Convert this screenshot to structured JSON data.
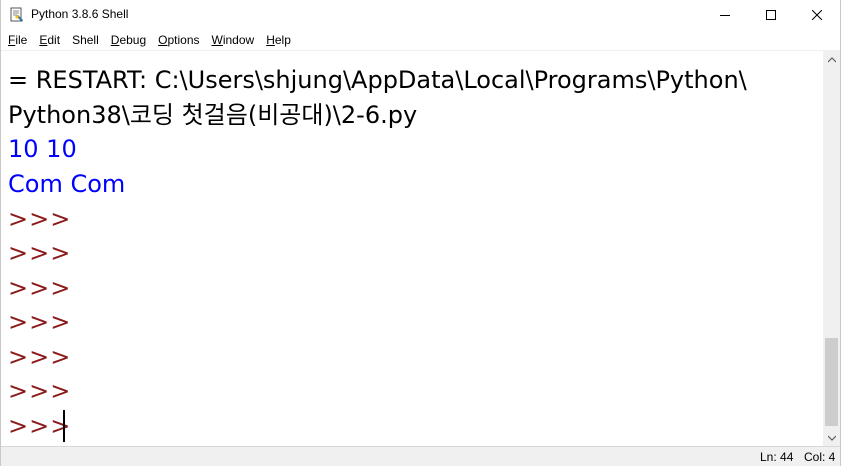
{
  "window": {
    "title": "Python 3.8.6 Shell",
    "icon": "python-idle-icon"
  },
  "menu": {
    "items": [
      {
        "label": "File",
        "accel": "F",
        "rest": "ile"
      },
      {
        "label": "Edit",
        "accel": "E",
        "rest": "dit"
      },
      {
        "label": "Shell",
        "accel": "S",
        "rest": "hell"
      },
      {
        "label": "Debug",
        "accel": "D",
        "rest": "ebug"
      },
      {
        "label": "Options",
        "accel": "O",
        "rest": "ptions"
      },
      {
        "label": "Window",
        "accel": "W",
        "rest": "indow"
      },
      {
        "label": "Help",
        "accel": "H",
        "rest": "elp"
      }
    ]
  },
  "shell": {
    "restart_line1": "= RESTART: C:\\Users\\shjung\\AppData\\Local\\Programs\\Python\\",
    "restart_line2": "Python38\\코딩 첫걸음(비공대)\\2-6.py",
    "output1": "10 10",
    "output2": "Com Com",
    "prompt": ">>>"
  },
  "status": {
    "ln": "Ln: 44",
    "col": "Col: 4"
  },
  "colors": {
    "stdout": "#0000ff",
    "prompt": "#8b1a1a",
    "text": "#000000"
  }
}
